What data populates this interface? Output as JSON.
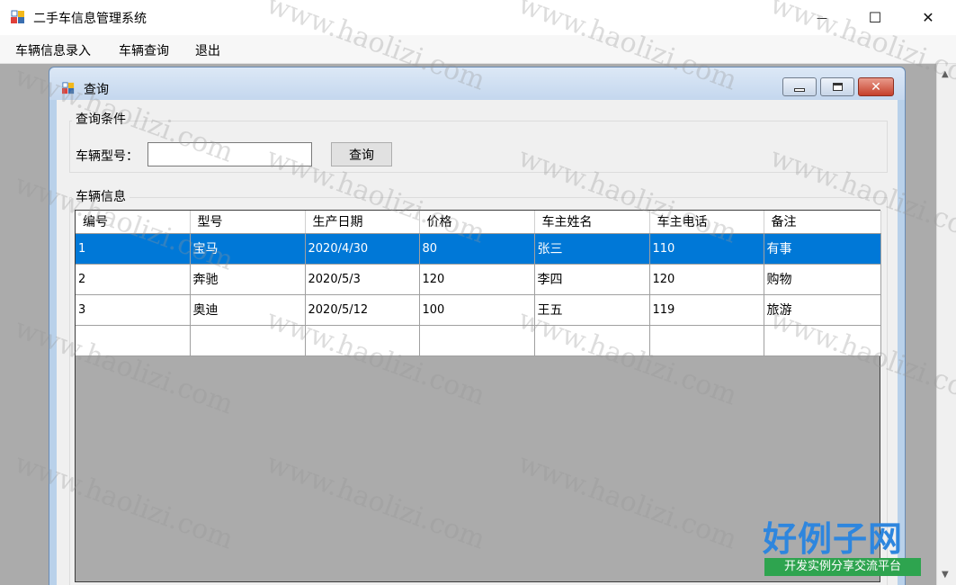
{
  "window": {
    "title": "二手车信息管理系统",
    "controls": {
      "minimize": "—",
      "maximize": "☐",
      "close": "✕"
    }
  },
  "menu": {
    "items": [
      "车辆信息录入",
      "车辆查询",
      "退出"
    ]
  },
  "child_window": {
    "title": "查询",
    "query_group": {
      "legend": "查询条件",
      "model_label": "车辆型号：",
      "model_value": "",
      "query_button": "查询"
    },
    "results_group": {
      "legend": "车辆信息",
      "columns": [
        "编号",
        "型号",
        "生产日期",
        "价格",
        "车主姓名",
        "车主电话",
        "备注"
      ],
      "rows": [
        [
          "1",
          "宝马",
          "2020/4/30",
          "80",
          "张三",
          "110",
          "有事"
        ],
        [
          "2",
          "奔驰",
          "2020/5/3",
          "120",
          "李四",
          "120",
          "购物"
        ],
        [
          "3",
          "奥迪",
          "2020/5/12",
          "100",
          "王五",
          "119",
          "旅游"
        ]
      ],
      "selected_row_index": 0
    }
  },
  "colors": {
    "selection": "#0078d7",
    "mdi_background": "#ababab",
    "child_frame": "#b9d1ea"
  },
  "watermark": {
    "text": "www.haolizi.com",
    "brand": "好例子网",
    "brand_sub": "开发实例分享交流平台"
  }
}
